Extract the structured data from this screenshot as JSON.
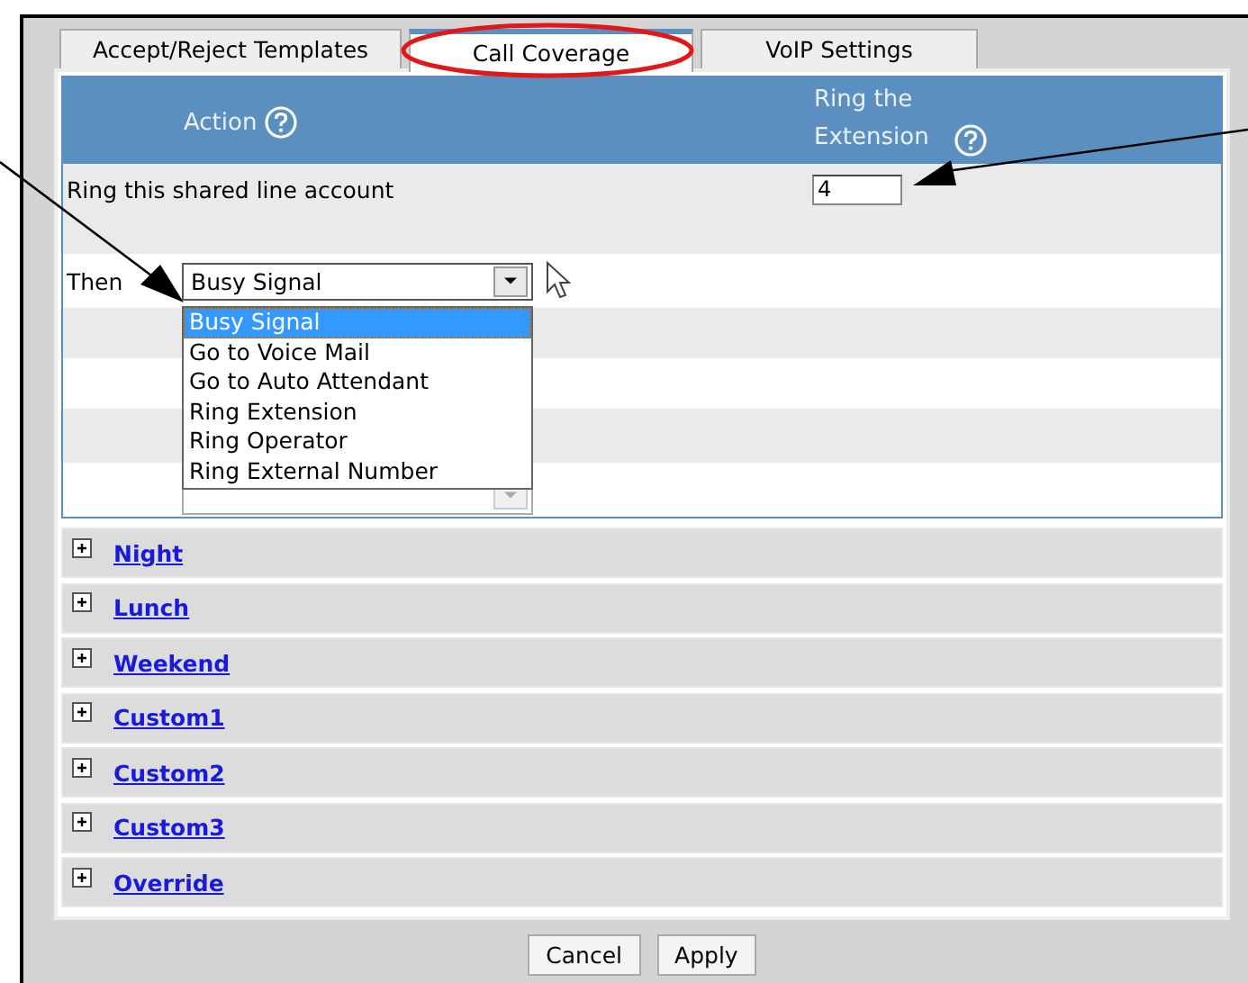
{
  "tabs": [
    {
      "label": "Accept/Reject Templates",
      "selected": false
    },
    {
      "label": "Call Coverage",
      "selected": true
    },
    {
      "label": "VoIP Settings",
      "selected": false
    }
  ],
  "table": {
    "columns": [
      {
        "label": "Action"
      },
      {
        "label": "Ring the Extension"
      }
    ],
    "ring_row": {
      "label": "Ring this shared line account",
      "value": "4"
    },
    "then_row": {
      "label": "Then",
      "value": "Busy Signal",
      "expanded": true,
      "options": [
        {
          "label": "Busy Signal",
          "selected": true
        },
        {
          "label": "Go to Voice Mail",
          "selected": false
        },
        {
          "label": "Go to Auto Attendant",
          "selected": false
        },
        {
          "label": "Ring Extension",
          "selected": false
        },
        {
          "label": "Ring Operator",
          "selected": false
        },
        {
          "label": "Ring External Number",
          "selected": false
        }
      ]
    }
  },
  "sections": [
    {
      "label": "Night",
      "expanded": false
    },
    {
      "label": "Lunch",
      "expanded": false
    },
    {
      "label": "Weekend",
      "expanded": false
    },
    {
      "label": "Custom1",
      "expanded": false
    },
    {
      "label": "Custom2",
      "expanded": false
    },
    {
      "label": "Custom3",
      "expanded": false
    },
    {
      "label": "Override",
      "expanded": false
    }
  ],
  "buttons": [
    "Cancel",
    "Apply"
  ]
}
